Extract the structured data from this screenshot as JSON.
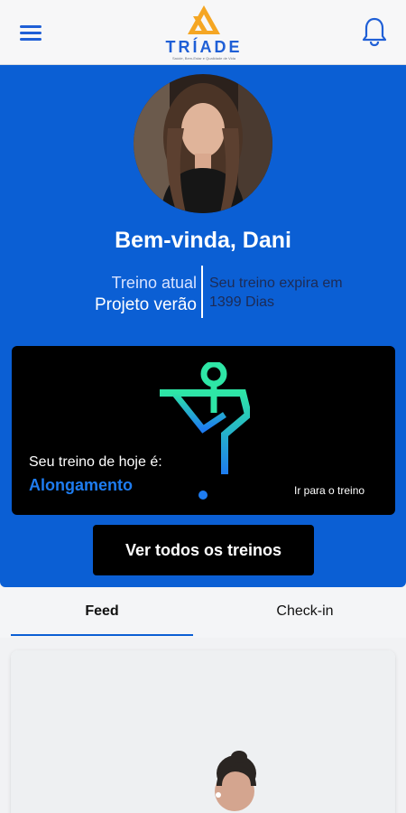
{
  "header": {
    "menu_icon": "hamburger-menu-icon",
    "logo_text": "TRÍADE",
    "logo_tagline": "Saúde, Bem-Estar e Qualidade de Vida",
    "notification_icon": "bell-icon",
    "accent_color": "#1f5fd6",
    "logo_color": "#f5a623"
  },
  "profile": {
    "welcome": "Bem-vinda, Dani",
    "current_label": "Treino atual",
    "current_value": "Projeto verão",
    "expiry_label": "Seu treino expira em",
    "expiry_value": "1399 Dias",
    "background_color": "#0b5fd4"
  },
  "today": {
    "label": "Seu treino de hoje é:",
    "workout": "Alongamento",
    "go_link": "Ir para o treino",
    "illustration_icon": "stretching-figure-icon"
  },
  "actions": {
    "all_workouts": "Ver todos os treinos"
  },
  "tabs": [
    {
      "label": "Feed",
      "active": true
    },
    {
      "label": "Check-in",
      "active": false
    }
  ]
}
